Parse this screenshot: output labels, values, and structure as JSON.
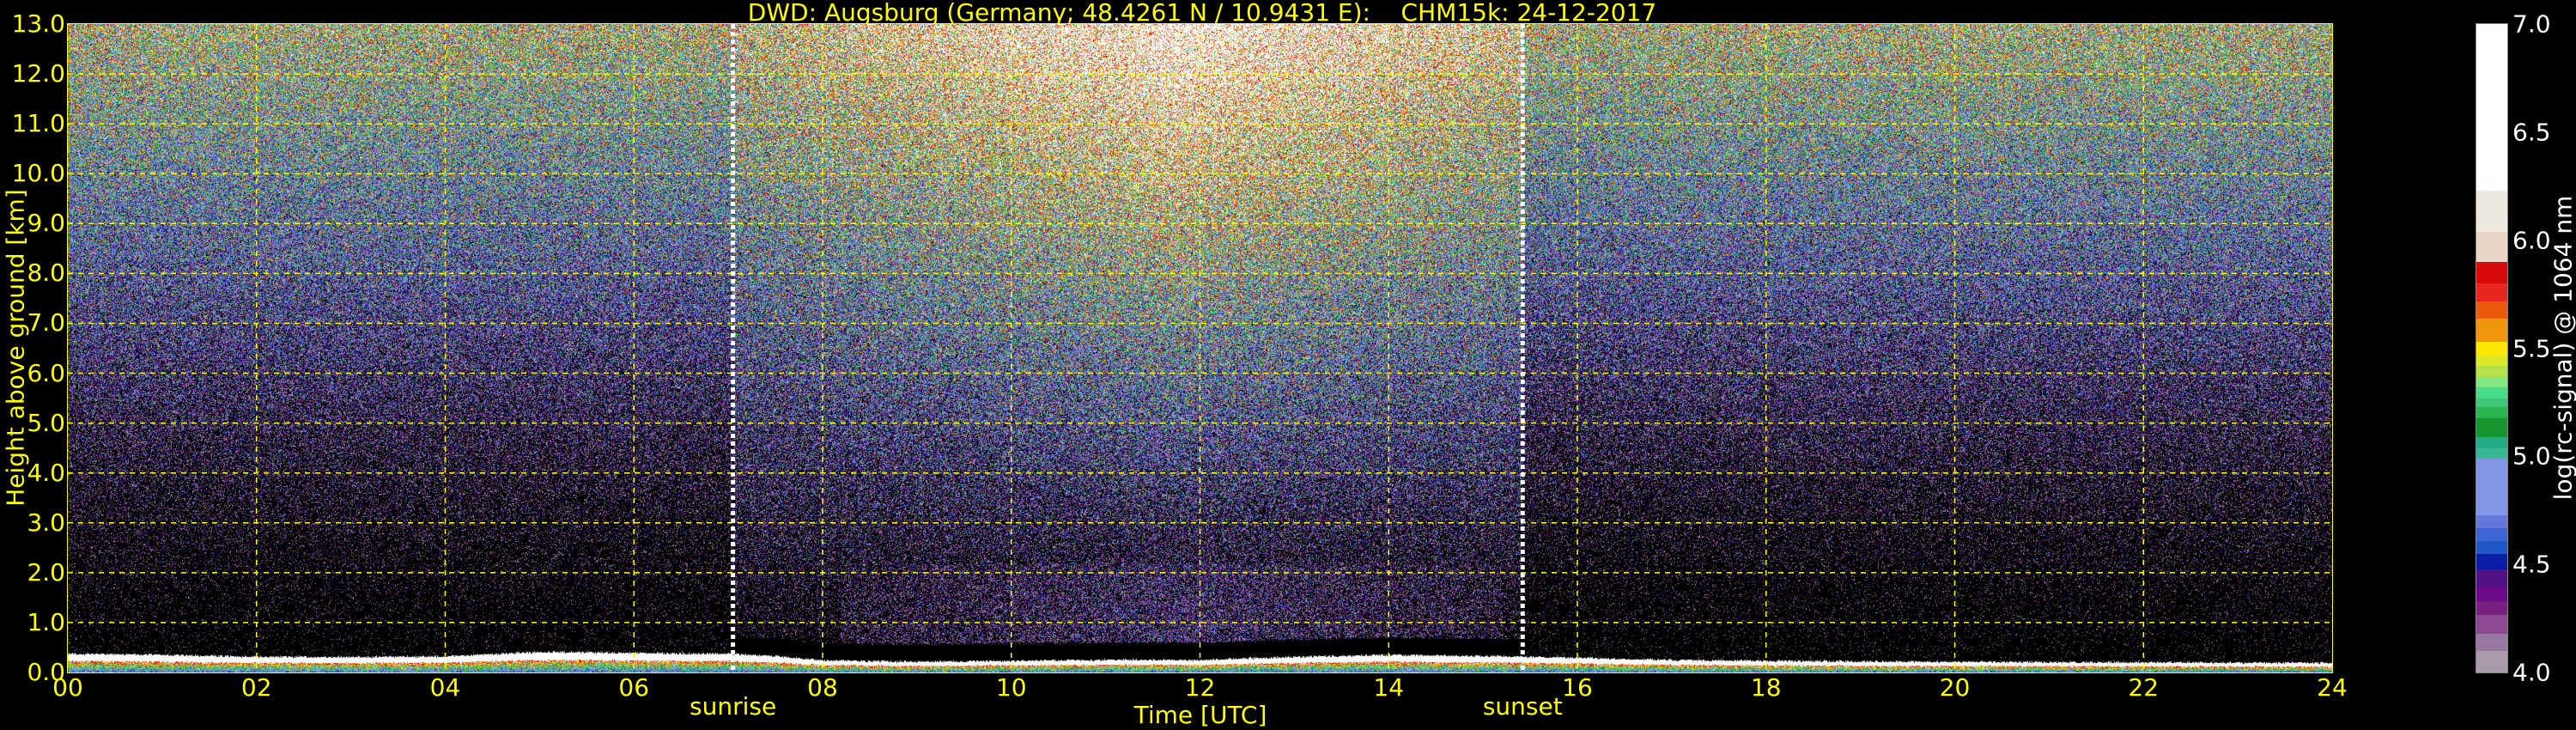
{
  "chart_data": {
    "type": "heatmap",
    "title": "DWD: Augsburg (Germany; 48.4261 N / 10.9431 E):    CHM15k: 24-12-2017",
    "xlabel": "Time [UTC]",
    "ylabel": "Height above ground [km]",
    "xlim": [
      0,
      24
    ],
    "ylim": [
      0,
      13
    ],
    "grid": true,
    "xticks": [
      0,
      2,
      4,
      6,
      8,
      10,
      12,
      14,
      16,
      18,
      20,
      22,
      24
    ],
    "xtick_labels": [
      "00",
      "02",
      "04",
      "06",
      "08",
      "10",
      "12",
      "14",
      "16",
      "18",
      "20",
      "22",
      "24"
    ],
    "yticks": [
      0,
      1,
      2,
      3,
      4,
      5,
      6,
      7,
      8,
      9,
      10,
      11,
      12,
      13
    ],
    "ytick_labels": [
      "0.0",
      "1.0",
      "2.0",
      "3.0",
      "4.0",
      "5.0",
      "6.0",
      "7.0",
      "8.0",
      "9.0",
      "10.0",
      "11.0",
      "12.0",
      "13.0"
    ],
    "annotations": [
      {
        "label": "sunrise",
        "time_h": 7.05
      },
      {
        "label": "sunset",
        "time_h": 15.42
      }
    ],
    "surface_layer_top_km": {
      "time_h": [
        0,
        1,
        2,
        3,
        4,
        5,
        6,
        7,
        7.5,
        8,
        9,
        10,
        11,
        12,
        13,
        14,
        15,
        16,
        17,
        18,
        20,
        22,
        24
      ],
      "height_km": [
        0.38,
        0.36,
        0.32,
        0.32,
        0.33,
        0.42,
        0.4,
        0.38,
        0.34,
        0.25,
        0.22,
        0.24,
        0.26,
        0.26,
        0.32,
        0.36,
        0.34,
        0.3,
        0.26,
        0.24,
        0.22,
        0.21,
        0.2
      ]
    },
    "colorbar": {
      "label": "log(rc-signal) @ 1064 nm",
      "range": [
        4.0,
        7.0
      ],
      "ticks": [
        4.0,
        4.5,
        5.0,
        5.5,
        6.0,
        6.5,
        7.0
      ],
      "tick_labels": [
        "4.0",
        "4.5",
        "5.0",
        "5.5",
        "6.0",
        "6.5",
        "7.0"
      ],
      "levels": [
        {
          "from": 4.0,
          "color": "#a89aa8"
        },
        {
          "from": 4.1,
          "color": "#9678a0"
        },
        {
          "from": 4.18,
          "color": "#8c4890"
        },
        {
          "from": 4.27,
          "color": "#782080"
        },
        {
          "from": 4.33,
          "color": "#6e0a8c"
        },
        {
          "from": 4.4,
          "color": "#501482"
        },
        {
          "from": 4.48,
          "color": "#0c1ea8"
        },
        {
          "from": 4.55,
          "color": "#2058c8"
        },
        {
          "from": 4.61,
          "color": "#3c64d2"
        },
        {
          "from": 4.67,
          "color": "#6478dc"
        },
        {
          "from": 4.73,
          "color": "#8296e6"
        },
        {
          "from": 4.99,
          "color": "#3ab894"
        },
        {
          "from": 5.04,
          "color": "#22aa88"
        },
        {
          "from": 5.09,
          "color": "#16962c"
        },
        {
          "from": 5.18,
          "color": "#2cb450"
        },
        {
          "from": 5.23,
          "color": "#40c878"
        },
        {
          "from": 5.27,
          "color": "#48dc8c"
        },
        {
          "from": 5.32,
          "color": "#82e682"
        },
        {
          "from": 5.37,
          "color": "#b4e048"
        },
        {
          "from": 5.42,
          "color": "#dde826"
        },
        {
          "from": 5.47,
          "color": "#ffe600"
        },
        {
          "from": 5.53,
          "color": "#f0960c"
        },
        {
          "from": 5.64,
          "color": "#ea5a0c"
        },
        {
          "from": 5.72,
          "color": "#e8251e"
        },
        {
          "from": 5.8,
          "color": "#d70a0a"
        },
        {
          "from": 5.9,
          "color": "#e8d6c6"
        },
        {
          "from": 6.04,
          "color": "#eee9e0"
        },
        {
          "from": 6.23,
          "color": "#ffffff"
        }
      ]
    },
    "colors": {
      "axis": "#ffff00",
      "grid": "#ffff00",
      "sun_lines": "#ffffff",
      "background": "#000000"
    }
  }
}
